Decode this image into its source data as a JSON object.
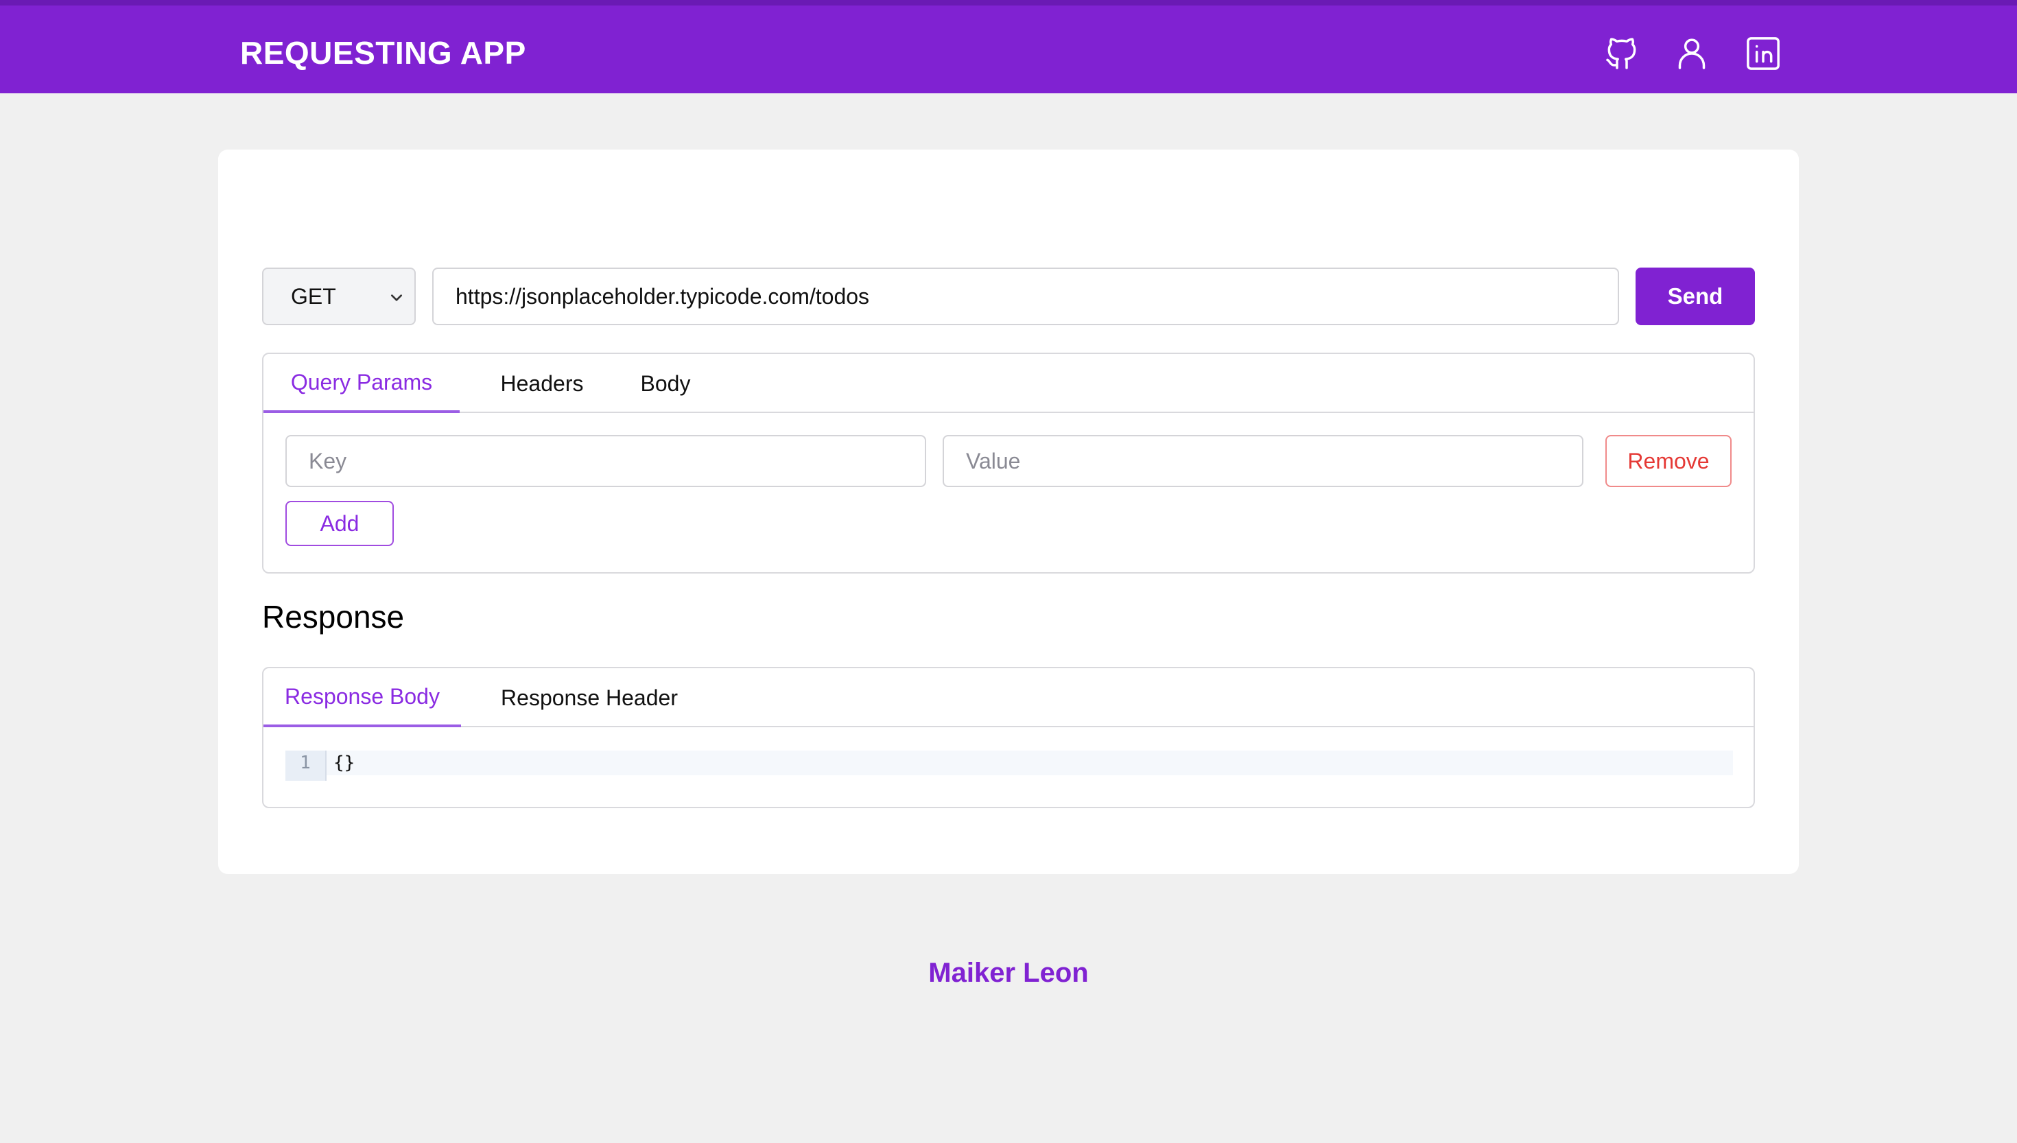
{
  "header": {
    "title": "REQUESTING APP",
    "icons": [
      "github-icon",
      "user-icon",
      "linkedin-icon"
    ]
  },
  "request": {
    "method": "GET",
    "url": "https://jsonplaceholder.typicode.com/todos",
    "send_label": "Send",
    "tabs": [
      "Query Params",
      "Headers",
      "Body"
    ],
    "active_tab": "Query Params",
    "params": {
      "key_placeholder": "Key",
      "value_placeholder": "Value",
      "remove_label": "Remove",
      "add_label": "Add"
    }
  },
  "response": {
    "title": "Response",
    "tabs": [
      "Response Body",
      "Response Header"
    ],
    "active_tab": "Response Body",
    "line_number": "1",
    "body": "{}"
  },
  "footer": {
    "author": "Maiker Leon"
  },
  "colors": {
    "primary": "#8022d2",
    "accent_tab": "#8a2be2",
    "danger": "#e53935",
    "background": "#f0f0f0"
  }
}
